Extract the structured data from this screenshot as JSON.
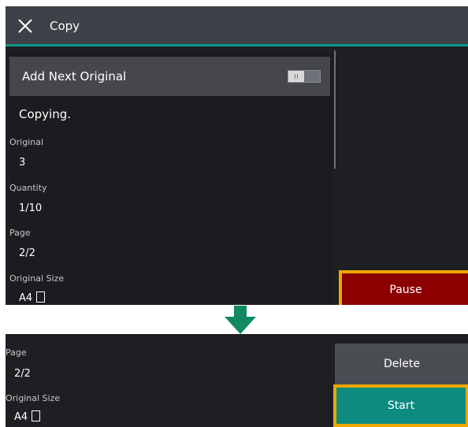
{
  "top_screen": {
    "title": "Copy",
    "add_next_original": {
      "label": "Add Next Original",
      "toggle_on": false
    },
    "status": "Copying.",
    "fields": [
      {
        "label": "Original",
        "value": "3"
      },
      {
        "label": "Quantity",
        "value": "1/10"
      },
      {
        "label": "Page",
        "value": "2/2"
      },
      {
        "label": "Original Size",
        "value": "A4"
      }
    ],
    "pause_label": "Pause"
  },
  "bottom_screen": {
    "fields": [
      {
        "label": "Page",
        "value": "2/2"
      },
      {
        "label": "Original Size",
        "value": "A4"
      }
    ],
    "delete_label": "Delete",
    "start_label": "Start"
  },
  "colors": {
    "accent": "#0f9a8d",
    "highlight": "#f0a800",
    "pause": "#8c0000",
    "start": "#0e8b80"
  }
}
